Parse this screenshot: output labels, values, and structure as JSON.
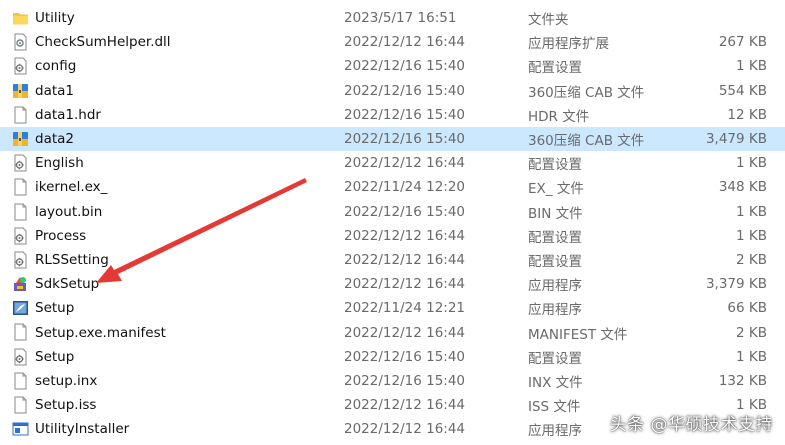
{
  "files": [
    {
      "name": "Utility",
      "date": "2023/5/17 16:51",
      "type": "文件夹",
      "size": "",
      "icon": "folder-icon"
    },
    {
      "name": "CheckSumHelper.dll",
      "date": "2022/12/12 16:44",
      "type": "应用程序扩展",
      "size": "267 KB",
      "icon": "dll-file-icon"
    },
    {
      "name": "config",
      "date": "2022/12/16 15:40",
      "type": "配置设置",
      "size": "1 KB",
      "icon": "settings-file-icon"
    },
    {
      "name": "data1",
      "date": "2022/12/16 15:40",
      "type": "360压缩 CAB 文件",
      "size": "554 KB",
      "icon": "archive-file-icon"
    },
    {
      "name": "data1.hdr",
      "date": "2022/12/16 15:40",
      "type": "HDR 文件",
      "size": "12 KB",
      "icon": "blank-file-icon"
    },
    {
      "name": "data2",
      "date": "2022/12/16 15:40",
      "type": "360压缩 CAB 文件",
      "size": "3,479 KB",
      "icon": "archive-file-icon",
      "selected": true
    },
    {
      "name": "English",
      "date": "2022/12/12 16:44",
      "type": "配置设置",
      "size": "1 KB",
      "icon": "settings-file-icon"
    },
    {
      "name": "ikernel.ex_",
      "date": "2022/11/24 12:20",
      "type": "EX_ 文件",
      "size": "348 KB",
      "icon": "blank-file-icon"
    },
    {
      "name": "layout.bin",
      "date": "2022/12/16 15:40",
      "type": "BIN 文件",
      "size": "1 KB",
      "icon": "blank-file-icon"
    },
    {
      "name": "Process",
      "date": "2022/12/12 16:44",
      "type": "配置设置",
      "size": "1 KB",
      "icon": "settings-file-icon"
    },
    {
      "name": "RLSSetting",
      "date": "2022/12/12 16:44",
      "type": "配置设置",
      "size": "2 KB",
      "icon": "settings-file-icon"
    },
    {
      "name": "SdkSetup",
      "date": "2022/12/12 16:44",
      "type": "应用程序",
      "size": "3,379 KB",
      "icon": "installer-app-icon"
    },
    {
      "name": "Setup",
      "date": "2022/11/24 12:21",
      "type": "应用程序",
      "size": "66 KB",
      "icon": "setup-app-icon"
    },
    {
      "name": "Setup.exe.manifest",
      "date": "2022/12/12 16:44",
      "type": "MANIFEST 文件",
      "size": "2 KB",
      "icon": "blank-file-icon"
    },
    {
      "name": "Setup",
      "date": "2022/12/16 15:40",
      "type": "配置设置",
      "size": "1 KB",
      "icon": "settings-file-icon"
    },
    {
      "name": "setup.inx",
      "date": "2022/12/16 15:40",
      "type": "INX 文件",
      "size": "132 KB",
      "icon": "blank-file-icon"
    },
    {
      "name": "Setup.iss",
      "date": "2022/12/12 16:44",
      "type": "ISS 文件",
      "size": "1 KB",
      "icon": "blank-file-icon"
    },
    {
      "name": "UtilityInstaller",
      "date": "2022/12/12 16:44",
      "type": "应用程序",
      "size": "",
      "icon": "installer-window-icon"
    }
  ],
  "watermark": "头条 @华硕技术支持",
  "colors": {
    "selected_row": "#cce8ff",
    "annotation_arrow": "#e53935",
    "folder": "#f3c34a"
  }
}
